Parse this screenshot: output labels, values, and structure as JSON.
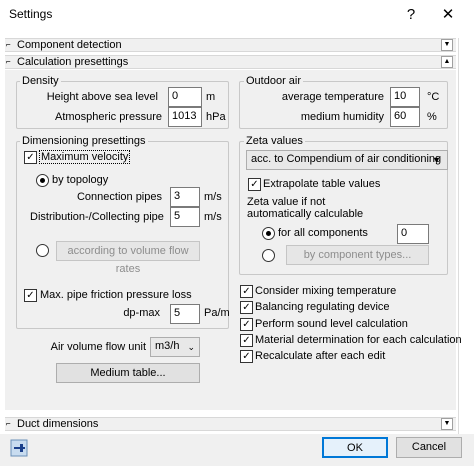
{
  "window": {
    "title": "Settings",
    "help": "?",
    "close": "✕"
  },
  "sections": {
    "component_detection": "Component detection",
    "calculation_presettings": "Calculation presettings",
    "duct_dimensions": "Duct dimensions"
  },
  "density": {
    "label": "Density",
    "height_label": "Height above sea level",
    "height_value": "0",
    "height_unit": "m",
    "pressure_label": "Atmospheric pressure",
    "pressure_value": "1013",
    "pressure_unit": "hPa"
  },
  "outdoor_air": {
    "label": "Outdoor air",
    "temp_label": "average temperature",
    "temp_value": "10",
    "temp_unit": "°C",
    "humidity_label": "medium humidity",
    "humidity_value": "60",
    "humidity_unit": "%"
  },
  "dimensioning": {
    "label": "Dimensioning presettings",
    "max_velocity": "Maximum velocity",
    "by_topology": "by topology",
    "connection_label": "Connection pipes",
    "connection_value": "3",
    "connection_unit": "m/s",
    "distribution_label": "Distribution-/Collecting pipe",
    "distribution_value": "5",
    "distribution_unit": "m/s",
    "volume_flow_button": "according to volume flow rates",
    "max_friction": "Max. pipe friction pressure loss",
    "dpmax_label": "dp-max",
    "dpmax_value": "5",
    "dpmax_unit": "Pa/m"
  },
  "zeta": {
    "label": "Zeta values",
    "selected": "acc. to Compendium of air conditioning",
    "extrapolate": "Extrapolate table values",
    "not_calc_line1": "Zeta value if not",
    "not_calc_line2": "automatically calculable",
    "all_components": "for all components",
    "all_components_value": "0",
    "by_types_button": "by component types..."
  },
  "options": {
    "mixing": "Consider mixing temperature",
    "balancing": "Balancing regulating device",
    "sound": "Perform sound level calculation",
    "material": "Material determination for each calculation",
    "recalculate": "Recalculate after each edit"
  },
  "air_volume": {
    "label": "Air volume flow unit",
    "selected": "m3/h"
  },
  "medium_table_button": "Medium table...",
  "footer": {
    "ok": "OK",
    "cancel": "Cancel"
  },
  "colors": {
    "focus_border": "#0078d7",
    "panel": "#f0f0f0"
  }
}
